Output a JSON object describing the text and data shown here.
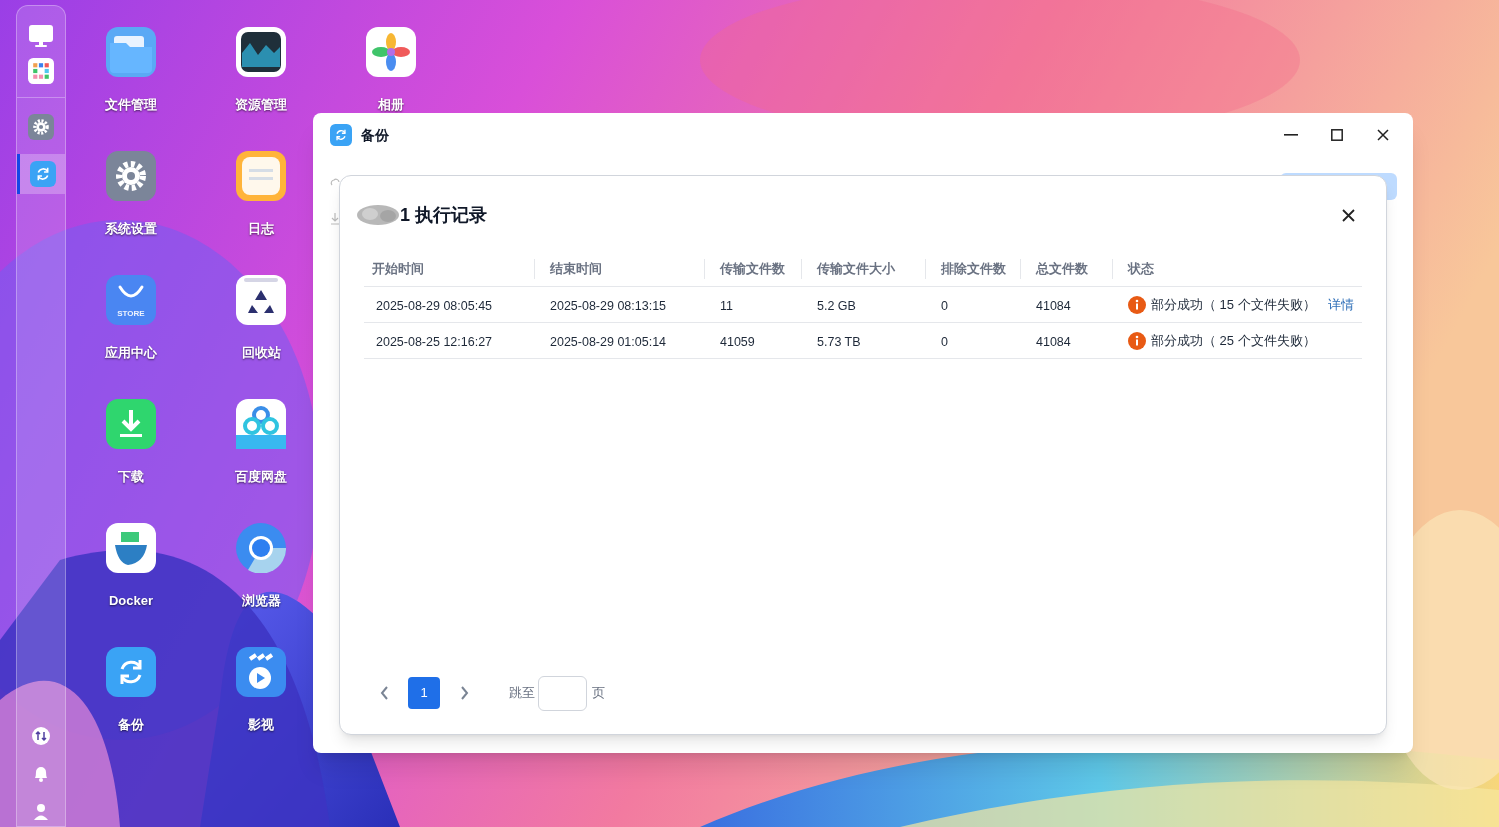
{
  "dock": {
    "top": [
      {
        "kind": "monitor"
      },
      {
        "kind": "apps"
      }
    ],
    "pinned": [
      {
        "kind": "settings",
        "selected": false
      },
      {
        "kind": "backup",
        "selected": true
      }
    ],
    "bottom": [
      {
        "kind": "transfer"
      },
      {
        "kind": "bell"
      },
      {
        "kind": "user"
      }
    ]
  },
  "desktop": {
    "apps": [
      {
        "label": "文件管理",
        "kind": "folder"
      },
      {
        "label": "系统设置",
        "kind": "settings"
      },
      {
        "label": "应用中心",
        "kind": "store",
        "badge": "STORE"
      },
      {
        "label": "下载",
        "kind": "download"
      },
      {
        "label": "Docker",
        "kind": "docker"
      },
      {
        "label": "备份",
        "kind": "backup"
      },
      {
        "label": "资源管理",
        "kind": "monitor"
      },
      {
        "label": "日志",
        "kind": "notes"
      },
      {
        "label": "回收站",
        "kind": "recycle"
      },
      {
        "label": "百度网盘",
        "kind": "cloud"
      },
      {
        "label": "浏览器",
        "kind": "browser"
      },
      {
        "label": "影视",
        "kind": "video"
      },
      {
        "label": "相册",
        "kind": "photos"
      }
    ]
  },
  "window": {
    "title": "备份"
  },
  "dialog": {
    "title": "1 执行记录",
    "table": {
      "columns": [
        "开始时间",
        "结束时间",
        "传输文件数",
        "传输文件大小",
        "排除文件数",
        "总文件数",
        "状态"
      ],
      "rows": [
        {
          "cells": [
            "2025-08-29 08:05:45",
            "2025-08-29 08:13:15",
            "11",
            "5.2 GB",
            "0",
            "41084"
          ],
          "status": "部分成功（ 15 个文件失败）",
          "link": "详情"
        },
        {
          "cells": [
            "2025-08-25 12:16:27",
            "2025-08-29 01:05:14",
            "41059",
            "5.73 TB",
            "0",
            "41084"
          ],
          "status": "部分成功（ 25 个文件失败）"
        }
      ]
    },
    "pagination": {
      "pages": [
        {
          "label": "1",
          "selected": true
        }
      ],
      "jump_label": "跳至",
      "jump_suffix": "页"
    }
  }
}
